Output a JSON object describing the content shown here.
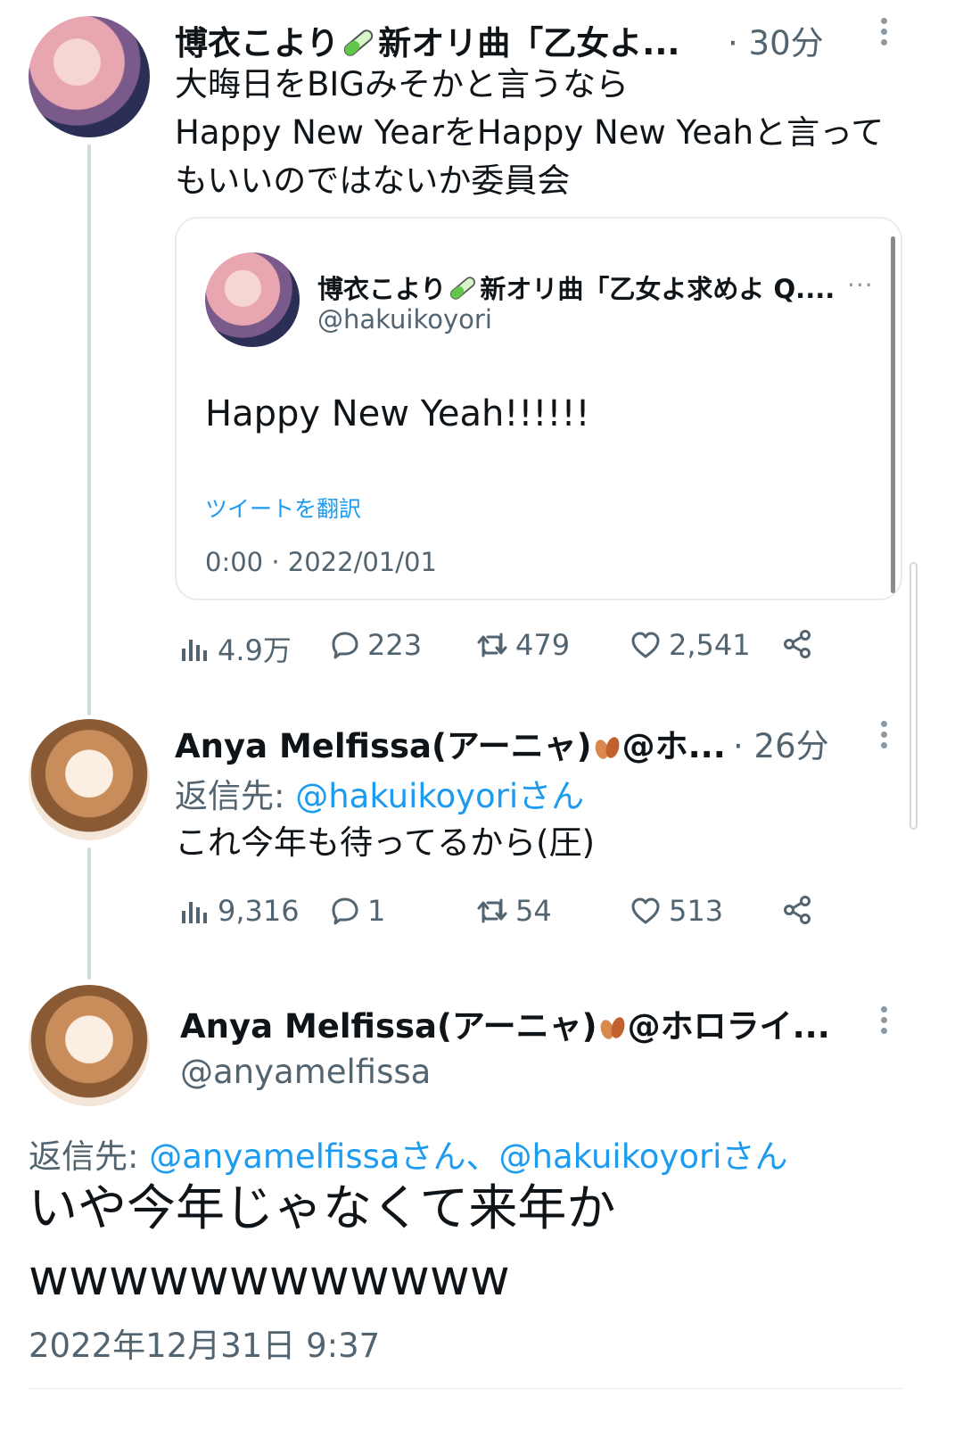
{
  "tweet1": {
    "name": "博衣こより",
    "name_suffix": "新オリ曲「乙女よ...",
    "time": "· 30分",
    "text": "大晦日をBIGみそかと言うなら\nHappy New YearをHappy New Yeahと言って\nもいいのではないか委員会",
    "quote": {
      "name": "博衣こより",
      "name_suffix": "新オリ曲「乙女よ求めよ Q....",
      "handle": "@hakuikoyori",
      "text": "Happy New Yeah!!!!!!",
      "translate": "ツイートを翻訳",
      "time": "0:00 · 2022/01/01"
    },
    "views": "4.9万",
    "replies": "223",
    "retweets": "479",
    "likes": "2,541"
  },
  "tweet2": {
    "name": "Anya Melfissa(アーニャ)",
    "name_suffix": "@ホ...",
    "time": "· 26分",
    "reply_prefix": "返信先: ",
    "reply_to": "@hakuikoyoriさん",
    "text": "これ今年も待ってるから(圧)",
    "views": "9,316",
    "replies": "1",
    "retweets": "54",
    "likes": "513"
  },
  "main_tweet": {
    "name": "Anya Melfissa(アーニャ)",
    "name_suffix": "@ホロライ...",
    "handle": "@anyamelfissa",
    "reply_prefix": "返信先: ",
    "reply_to": "@anyamelfissaさん、@hakuikoyoriさん",
    "text_line1": "いや今年じゃなくて来年か",
    "text_line2": "wwwwwwwwwwww",
    "timestamp": "2022年12月31日 9:37"
  },
  "icons": [
    "more-icon",
    "views-icon",
    "reply-icon",
    "retweet-icon",
    "like-icon",
    "share-icon",
    "test-tube-icon",
    "leaf-icon"
  ],
  "colors": {
    "accent": "#1d9bf0",
    "muted": "#536471",
    "text": "#0f1419",
    "border": "#e6ecf0"
  }
}
